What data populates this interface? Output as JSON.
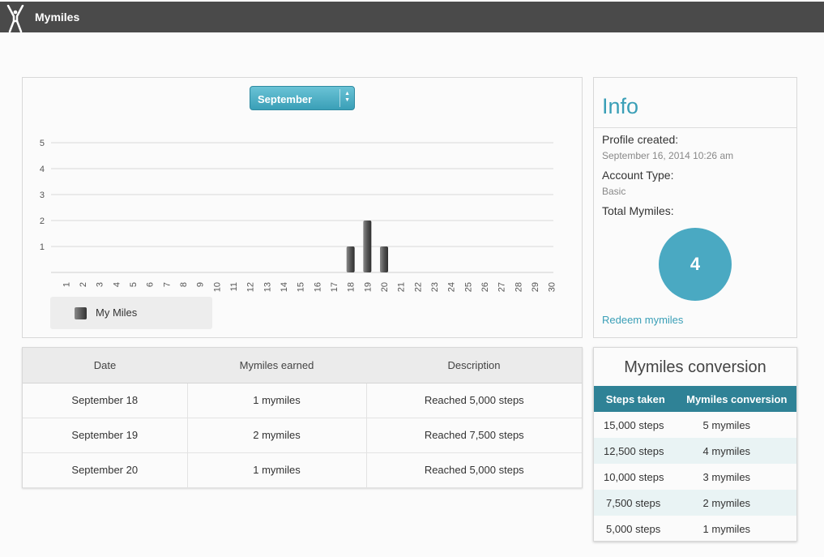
{
  "header": {
    "app_title": "Mymiles"
  },
  "chart_panel": {
    "month_select": "September",
    "chart_data": {
      "type": "bar",
      "categories": [
        "1",
        "2",
        "3",
        "4",
        "5",
        "6",
        "7",
        "8",
        "9",
        "10",
        "11",
        "12",
        "13",
        "14",
        "15",
        "16",
        "17",
        "18",
        "19",
        "20",
        "21",
        "22",
        "23",
        "24",
        "25",
        "26",
        "27",
        "28",
        "29",
        "30"
      ],
      "series": [
        {
          "name": "My Miles",
          "values": [
            0,
            0,
            0,
            0,
            0,
            0,
            0,
            0,
            0,
            0,
            0,
            0,
            0,
            0,
            0,
            0,
            0,
            1,
            2,
            1,
            0,
            0,
            0,
            0,
            0,
            0,
            0,
            0,
            0,
            0
          ]
        }
      ],
      "y_ticks": [
        1,
        2,
        3,
        4,
        5
      ],
      "ylim": [
        0,
        5
      ],
      "grid": true,
      "legend": "bottom-left"
    },
    "legend_label": "My Miles"
  },
  "info": {
    "title": "Info",
    "profile_created_label": "Profile created:",
    "profile_created_value": "September 16, 2014 10:26 am",
    "account_type_label": "Account Type:",
    "account_type_value": "Basic",
    "total_label": "Total Mymiles:",
    "total_value": "4",
    "redeem_link": "Redeem mymiles"
  },
  "earnings": {
    "headers": [
      "Date",
      "Mymiles earned",
      "Description"
    ],
    "rows": [
      [
        "September 18",
        "1 mymiles",
        "Reached 5,000 steps"
      ],
      [
        "September 19",
        "2 mymiles",
        "Reached 7,500 steps"
      ],
      [
        "September 20",
        "1 mymiles",
        "Reached 5,000 steps"
      ]
    ]
  },
  "conversion": {
    "title": "Mymiles conversion",
    "headers": [
      "Steps taken",
      "Mymiles conversion"
    ],
    "rows": [
      [
        "15,000 steps",
        "5 mymiles"
      ],
      [
        "12,500 steps",
        "4 mymiles"
      ],
      [
        "10,000 steps",
        "3 mymiles"
      ],
      [
        "7,500 steps",
        "2 mymiles"
      ],
      [
        "5,000 steps",
        "1 mymiles"
      ]
    ]
  },
  "colors": {
    "accent": "#3a9fb7",
    "header_bar": "#4a4a4a",
    "table_head": "#2f8296"
  }
}
